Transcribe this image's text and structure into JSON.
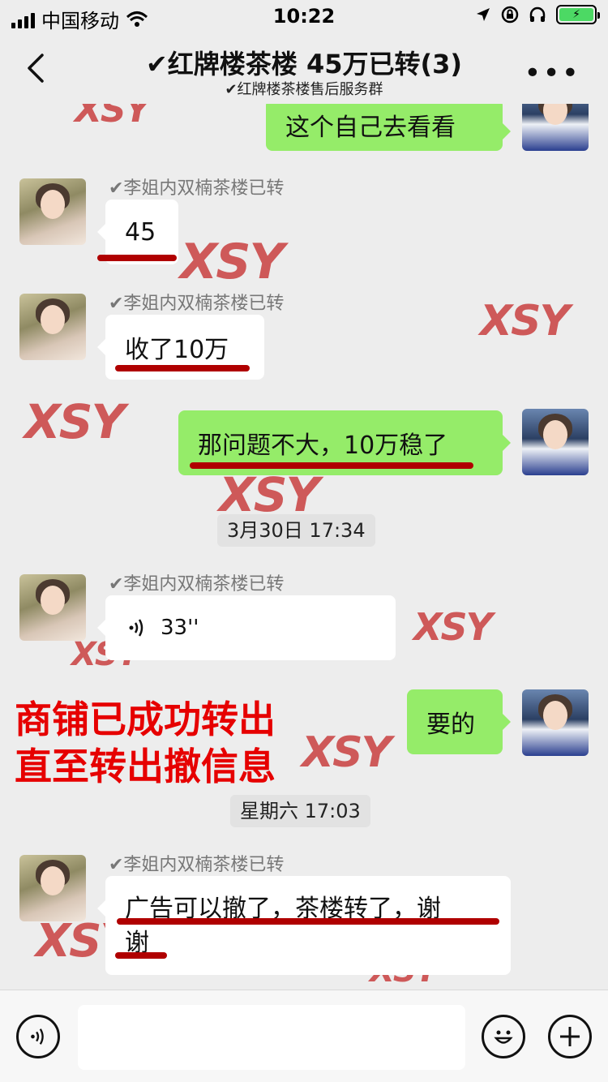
{
  "status_bar": {
    "carrier": "中国移动",
    "time": "10:22"
  },
  "header": {
    "title": "✔红牌楼茶楼 45万已转(3)",
    "subtitle": "✔红牌楼茶楼售后服务群",
    "more": "•••"
  },
  "watermark_text": "XSY",
  "messages": [
    {
      "side": "right",
      "text": "这个自己去看看"
    },
    {
      "side": "left",
      "sender": "✔李姐内双楠茶楼已转",
      "text": "45"
    },
    {
      "side": "left",
      "sender": "✔李姐内双楠茶楼已转",
      "text": "收了10万"
    },
    {
      "side": "right",
      "text": "那问题不大，10万稳了"
    },
    {
      "timestamp": "3月30日 17:34"
    },
    {
      "side": "left",
      "sender": "✔李姐内双楠茶楼已转",
      "voice_duration": "33''"
    },
    {
      "side": "right",
      "text": "要的"
    },
    {
      "timestamp": "星期六 17:03"
    },
    {
      "side": "left",
      "sender": "✔李姐内双楠茶楼已转",
      "text_line1": "广告可以撤了，茶楼转了，谢",
      "text_line2": "谢"
    }
  ],
  "overlay": {
    "line1": "商铺已成功转出",
    "line2": "直至转出撤信息"
  },
  "colors": {
    "background": "#ededed",
    "bubble_green": "#95ec69",
    "underline": "#b00000",
    "overlay_red": "#e60000"
  }
}
